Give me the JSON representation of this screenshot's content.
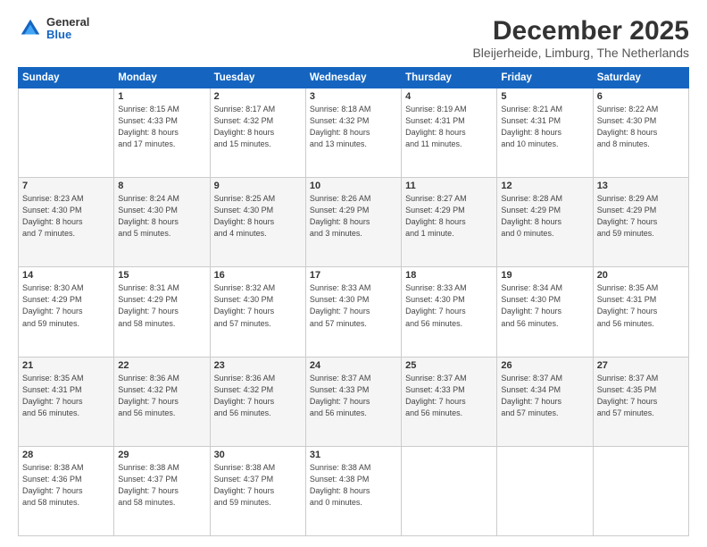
{
  "header": {
    "logo": {
      "general": "General",
      "blue": "Blue"
    },
    "title": "December 2025",
    "location": "Bleijerheide, Limburg, The Netherlands"
  },
  "calendar": {
    "headers": [
      "Sunday",
      "Monday",
      "Tuesday",
      "Wednesday",
      "Thursday",
      "Friday",
      "Saturday"
    ],
    "weeks": [
      [
        {
          "day": "",
          "info": ""
        },
        {
          "day": "1",
          "info": "Sunrise: 8:15 AM\nSunset: 4:33 PM\nDaylight: 8 hours\nand 17 minutes."
        },
        {
          "day": "2",
          "info": "Sunrise: 8:17 AM\nSunset: 4:32 PM\nDaylight: 8 hours\nand 15 minutes."
        },
        {
          "day": "3",
          "info": "Sunrise: 8:18 AM\nSunset: 4:32 PM\nDaylight: 8 hours\nand 13 minutes."
        },
        {
          "day": "4",
          "info": "Sunrise: 8:19 AM\nSunset: 4:31 PM\nDaylight: 8 hours\nand 11 minutes."
        },
        {
          "day": "5",
          "info": "Sunrise: 8:21 AM\nSunset: 4:31 PM\nDaylight: 8 hours\nand 10 minutes."
        },
        {
          "day": "6",
          "info": "Sunrise: 8:22 AM\nSunset: 4:30 PM\nDaylight: 8 hours\nand 8 minutes."
        }
      ],
      [
        {
          "day": "7",
          "info": "Sunrise: 8:23 AM\nSunset: 4:30 PM\nDaylight: 8 hours\nand 7 minutes."
        },
        {
          "day": "8",
          "info": "Sunrise: 8:24 AM\nSunset: 4:30 PM\nDaylight: 8 hours\nand 5 minutes."
        },
        {
          "day": "9",
          "info": "Sunrise: 8:25 AM\nSunset: 4:30 PM\nDaylight: 8 hours\nand 4 minutes."
        },
        {
          "day": "10",
          "info": "Sunrise: 8:26 AM\nSunset: 4:29 PM\nDaylight: 8 hours\nand 3 minutes."
        },
        {
          "day": "11",
          "info": "Sunrise: 8:27 AM\nSunset: 4:29 PM\nDaylight: 8 hours\nand 1 minute."
        },
        {
          "day": "12",
          "info": "Sunrise: 8:28 AM\nSunset: 4:29 PM\nDaylight: 8 hours\nand 0 minutes."
        },
        {
          "day": "13",
          "info": "Sunrise: 8:29 AM\nSunset: 4:29 PM\nDaylight: 7 hours\nand 59 minutes."
        }
      ],
      [
        {
          "day": "14",
          "info": "Sunrise: 8:30 AM\nSunset: 4:29 PM\nDaylight: 7 hours\nand 59 minutes."
        },
        {
          "day": "15",
          "info": "Sunrise: 8:31 AM\nSunset: 4:29 PM\nDaylight: 7 hours\nand 58 minutes."
        },
        {
          "day": "16",
          "info": "Sunrise: 8:32 AM\nSunset: 4:30 PM\nDaylight: 7 hours\nand 57 minutes."
        },
        {
          "day": "17",
          "info": "Sunrise: 8:33 AM\nSunset: 4:30 PM\nDaylight: 7 hours\nand 57 minutes."
        },
        {
          "day": "18",
          "info": "Sunrise: 8:33 AM\nSunset: 4:30 PM\nDaylight: 7 hours\nand 56 minutes."
        },
        {
          "day": "19",
          "info": "Sunrise: 8:34 AM\nSunset: 4:30 PM\nDaylight: 7 hours\nand 56 minutes."
        },
        {
          "day": "20",
          "info": "Sunrise: 8:35 AM\nSunset: 4:31 PM\nDaylight: 7 hours\nand 56 minutes."
        }
      ],
      [
        {
          "day": "21",
          "info": "Sunrise: 8:35 AM\nSunset: 4:31 PM\nDaylight: 7 hours\nand 56 minutes."
        },
        {
          "day": "22",
          "info": "Sunrise: 8:36 AM\nSunset: 4:32 PM\nDaylight: 7 hours\nand 56 minutes."
        },
        {
          "day": "23",
          "info": "Sunrise: 8:36 AM\nSunset: 4:32 PM\nDaylight: 7 hours\nand 56 minutes."
        },
        {
          "day": "24",
          "info": "Sunrise: 8:37 AM\nSunset: 4:33 PM\nDaylight: 7 hours\nand 56 minutes."
        },
        {
          "day": "25",
          "info": "Sunrise: 8:37 AM\nSunset: 4:33 PM\nDaylight: 7 hours\nand 56 minutes."
        },
        {
          "day": "26",
          "info": "Sunrise: 8:37 AM\nSunset: 4:34 PM\nDaylight: 7 hours\nand 57 minutes."
        },
        {
          "day": "27",
          "info": "Sunrise: 8:37 AM\nSunset: 4:35 PM\nDaylight: 7 hours\nand 57 minutes."
        }
      ],
      [
        {
          "day": "28",
          "info": "Sunrise: 8:38 AM\nSunset: 4:36 PM\nDaylight: 7 hours\nand 58 minutes."
        },
        {
          "day": "29",
          "info": "Sunrise: 8:38 AM\nSunset: 4:37 PM\nDaylight: 7 hours\nand 58 minutes."
        },
        {
          "day": "30",
          "info": "Sunrise: 8:38 AM\nSunset: 4:37 PM\nDaylight: 7 hours\nand 59 minutes."
        },
        {
          "day": "31",
          "info": "Sunrise: 8:38 AM\nSunset: 4:38 PM\nDaylight: 8 hours\nand 0 minutes."
        },
        {
          "day": "",
          "info": ""
        },
        {
          "day": "",
          "info": ""
        },
        {
          "day": "",
          "info": ""
        }
      ]
    ]
  }
}
